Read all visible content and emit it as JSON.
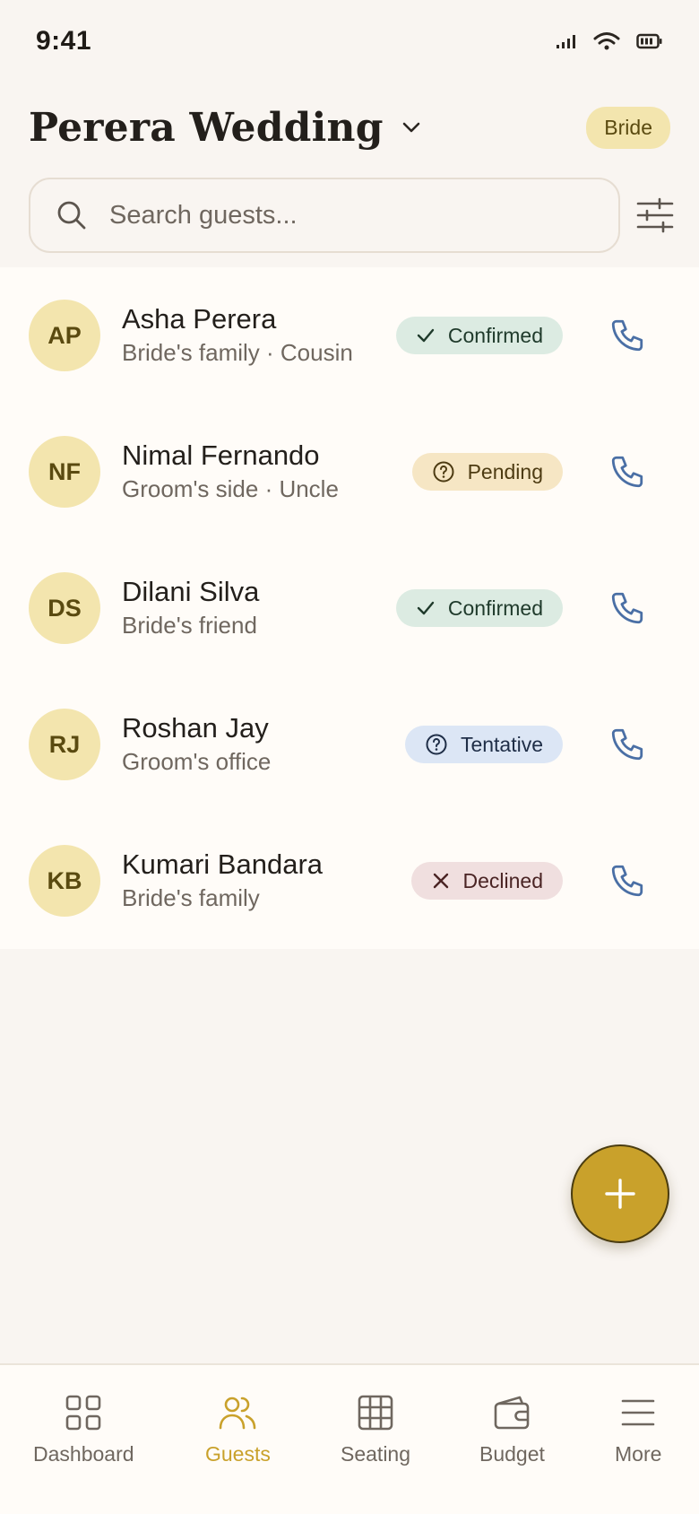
{
  "status_bar": {
    "time": "9:41"
  },
  "header": {
    "title": "Perera Wedding",
    "role_badge": "Bride"
  },
  "search": {
    "placeholder": "Search guests..."
  },
  "guests": [
    {
      "initials": "AP",
      "name": "Asha Perera",
      "subtitle": "Bride's family · Cousin",
      "status": "Confirmed",
      "status_icon": "check-icon"
    },
    {
      "initials": "NF",
      "name": "Nimal Fernando",
      "subtitle": "Groom's side · Uncle",
      "status": "Pending",
      "status_icon": "question-circle-icon"
    },
    {
      "initials": "DS",
      "name": "Dilani Silva",
      "subtitle": "Bride's friend",
      "status": "Confirmed",
      "status_icon": "check-icon"
    },
    {
      "initials": "RJ",
      "name": "Roshan Jay",
      "subtitle": "Groom's office",
      "status": "Tentative",
      "status_icon": "question-circle-icon"
    },
    {
      "initials": "KB",
      "name": "Kumari Bandara",
      "subtitle": "Bride's family",
      "status": "Declined",
      "status_icon": "x-icon"
    }
  ],
  "fab": {
    "icon": "plus-icon"
  },
  "bottom_nav": {
    "items": [
      {
        "label": "Dashboard",
        "icon": "grid-icon"
      },
      {
        "label": "Guests",
        "icon": "users-icon",
        "active": true
      },
      {
        "label": "Seating",
        "icon": "table-grid-icon"
      },
      {
        "label": "Budget",
        "icon": "wallet-icon"
      },
      {
        "label": "More",
        "icon": "menu-icon"
      }
    ]
  },
  "colors": {
    "background": "#f9f5f1",
    "accent": "#c9a12b",
    "avatar_bg": "#f3e5ae",
    "confirmed_bg": "#dcebe2",
    "pending_bg": "#f6e6c4",
    "tentative_bg": "#dce6f5",
    "declined_bg": "#f0dfdf",
    "phone_icon": "#4a6fa5"
  }
}
